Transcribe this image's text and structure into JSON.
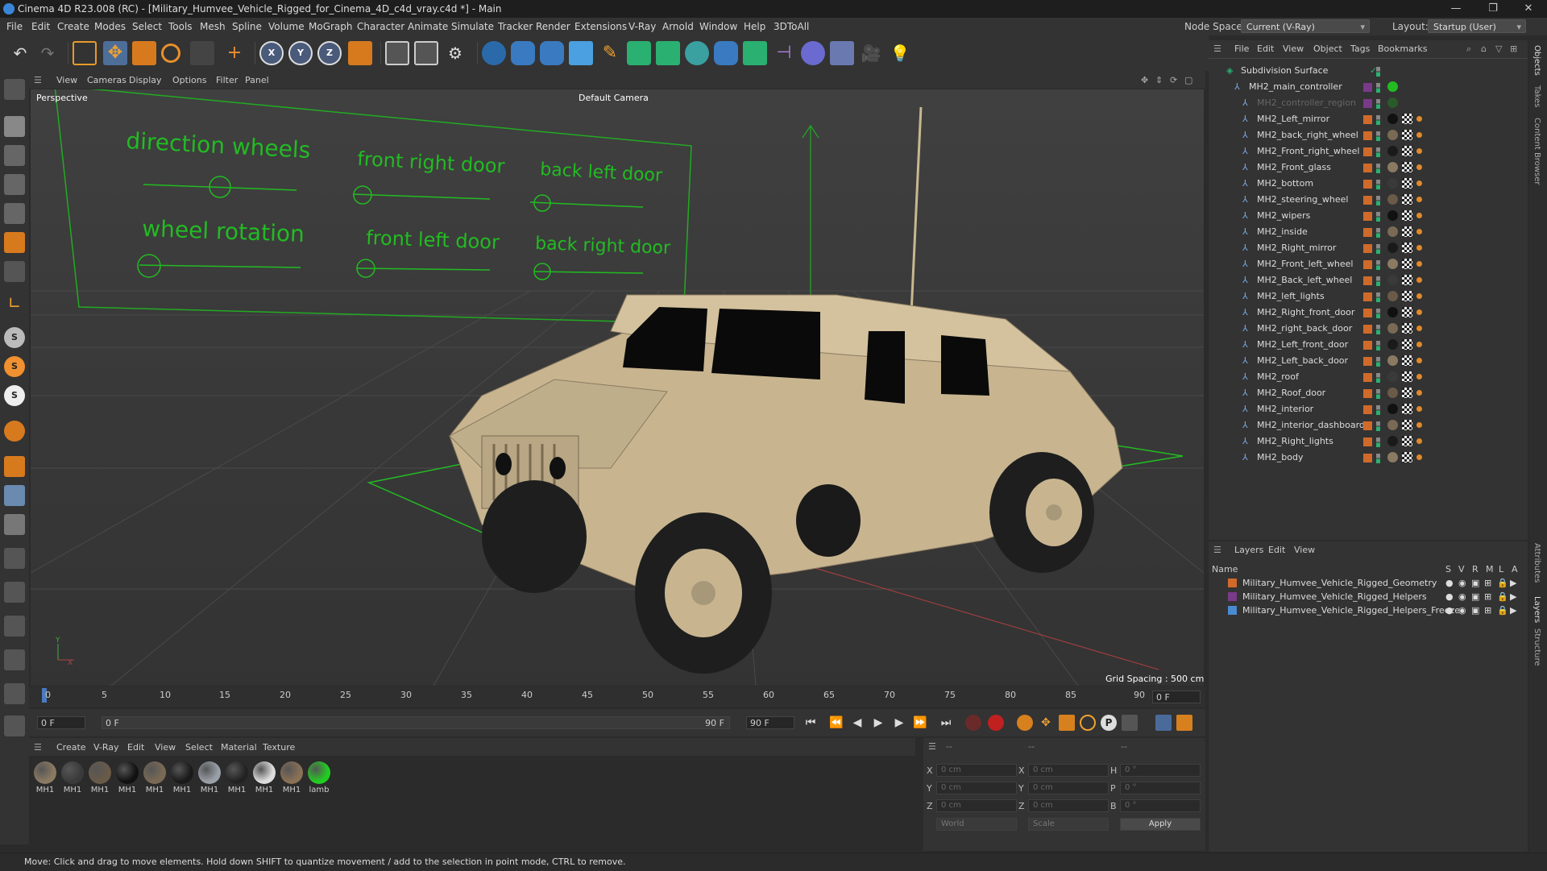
{
  "window": {
    "title": "Cinema 4D R23.008 (RC) - [Military_Humvee_Vehicle_Rigged_for_Cinema_4D_c4d_vray.c4d *] - Main"
  },
  "menu": [
    "File",
    "Edit",
    "Create",
    "Modes",
    "Select",
    "Tools",
    "Mesh",
    "Spline",
    "Volume",
    "MoGraph",
    "Character",
    "Animate",
    "Simulate",
    "Tracker",
    "Render",
    "Extensions",
    "V-Ray",
    "Arnold",
    "Window",
    "Help",
    "3DToAll"
  ],
  "node_space": {
    "label": "Node Space:",
    "value": "Current (V-Ray)"
  },
  "layout": {
    "label": "Layout:",
    "value": "Startup (User)"
  },
  "viewport": {
    "menu": [
      "View",
      "Cameras",
      "Display",
      "Options",
      "Filter",
      "Panel"
    ],
    "view_name": "Perspective",
    "camera": "Default Camera",
    "grid_spacing": "Grid Spacing : 500 cm",
    "controls": [
      "direction wheels",
      "front right door",
      "back left door",
      "wheel rotation",
      "front left door",
      "back right door"
    ]
  },
  "timeline": {
    "ticks": [
      "0",
      "5",
      "10",
      "15",
      "20",
      "25",
      "30",
      "35",
      "40",
      "45",
      "50",
      "55",
      "60",
      "65",
      "70",
      "75",
      "80",
      "85",
      "90"
    ],
    "current_frame": "0 F",
    "start_frame": "0 F",
    "range_start": "0 F",
    "range_end": "90 F",
    "end_frame": "90 F"
  },
  "material_manager": {
    "menu": [
      "Create",
      "V-Ray",
      "Edit",
      "View",
      "Select",
      "Material",
      "Texture"
    ],
    "materials": [
      "MH1",
      "MH1",
      "MH1",
      "MH1",
      "MH1",
      "MH1",
      "MH1",
      "MH1",
      "MH1",
      "MH1",
      "lamb"
    ],
    "colors": [
      "#8a7a62",
      "#3a3a3a",
      "#6a5a48",
      "#111111",
      "#7a6a55",
      "#1a1a1a",
      "#9aa0a8",
      "#222222",
      "#dddddd",
      "#8a7055",
      "#22cc22"
    ]
  },
  "coordinates": {
    "header": "--",
    "x_pos": "0 cm",
    "y_pos": "0 cm",
    "z_pos": "0 cm",
    "x_size": "0 cm",
    "y_size": "0 cm",
    "z_size": "0 cm",
    "h": "0 °",
    "p": "0 °",
    "b": "0 °",
    "labels": {
      "x": "X",
      "y": "Y",
      "z": "Z",
      "h": "H",
      "p": "P",
      "b": "B"
    },
    "mode1": "World",
    "mode2": "Scale",
    "apply": "Apply"
  },
  "object_manager": {
    "menu": [
      "File",
      "Edit",
      "View",
      "Object",
      "Tags",
      "Bookmarks"
    ],
    "objects": [
      "Subdivision Surface",
      "MH2_main_controller",
      "MH2_controller_region",
      "MH2_Left_mirror",
      "MH2_back_right_wheel",
      "MH2_Front_right_wheel",
      "MH2_Front_glass",
      "MH2_bottom",
      "MH2_steering_wheel",
      "MH2_wipers",
      "MH2_inside",
      "MH2_Right_mirror",
      "MH2_Front_left_wheel",
      "MH2_Back_left_wheel",
      "MH2_left_lights",
      "MH2_Right_front_door",
      "MH2_right_back_door",
      "MH2_Left_front_door",
      "MH2_Left_back_door",
      "MH2_roof",
      "MH2_Roof_door",
      "MH2_interior",
      "MH2_interior_dashboard",
      "MH2_Right_lights",
      "MH2_body"
    ]
  },
  "layer_manager": {
    "menu": [
      "Layers",
      "Edit",
      "View"
    ],
    "columns": {
      "name": "Name",
      "s": "S",
      "v": "V",
      "r": "R",
      "m": "M",
      "l": "L",
      "a": "A"
    },
    "layers": [
      {
        "name": "Military_Humvee_Vehicle_Rigged_Geometry",
        "color": "#d06a2a"
      },
      {
        "name": "Military_Humvee_Vehicle_Rigged_Helpers",
        "color": "#7a3a8a"
      },
      {
        "name": "Military_Humvee_Vehicle_Rigged_Helpers_Freeze",
        "color": "#4a8ad0"
      }
    ]
  },
  "side_tabs": [
    "Objects",
    "Takes",
    "Content Browser",
    "Attributes",
    "Layers",
    "Structure"
  ],
  "status": "Move: Click and drag to move elements. Hold down SHIFT to quantize movement / add to the selection in point mode, CTRL to remove."
}
